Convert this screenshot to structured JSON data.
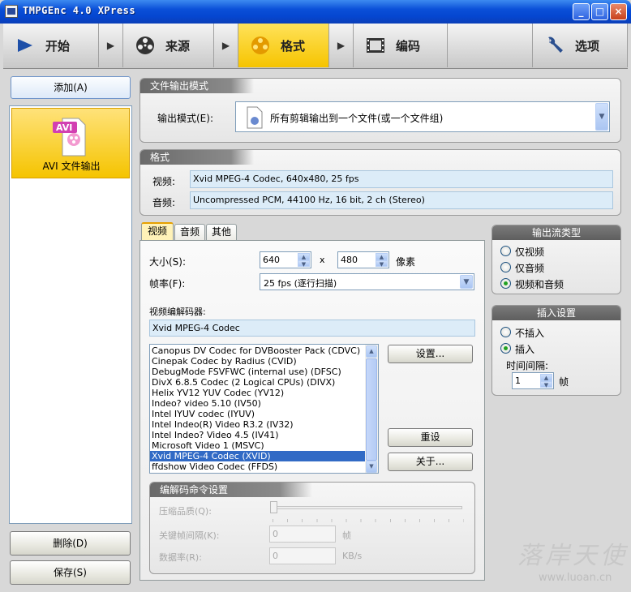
{
  "window": {
    "title": "TMPGEnc 4.0 XPress",
    "controls": {
      "minimize": "_",
      "maximize": "□",
      "close": "×"
    }
  },
  "nav": {
    "tabs": [
      {
        "label": "开始",
        "icon": "play-icon"
      },
      {
        "label": "来源",
        "icon": "film-reel-icon"
      },
      {
        "label": "格式",
        "icon": "film-reel-icon",
        "active": true
      },
      {
        "label": "编码",
        "icon": "filmstrip-icon"
      },
      {
        "label": "选项",
        "icon": "wrench-icon"
      }
    ],
    "arrow": "▶"
  },
  "left": {
    "add_label": "添加(A)",
    "items": [
      {
        "label": "AVI 文件输出",
        "badge": "AVI"
      }
    ],
    "delete_label": "删除(D)",
    "save_label": "保存(S)"
  },
  "output_mode": {
    "header": "文件输出模式",
    "label": "输出模式(E):",
    "value": "所有剪辑输出到一个文件(或一个文件组)"
  },
  "format": {
    "header": "格式",
    "video_label": "视频:",
    "video_value": "Xvid MPEG-4 Codec, 640x480, 25 fps",
    "audio_label": "音频:",
    "audio_value": "Uncompressed PCM, 44100 Hz, 16 bit, 2 ch (Stereo)"
  },
  "tabs": [
    "视频",
    "音频",
    "其他"
  ],
  "video": {
    "size_label": "大小(S):",
    "width": "640",
    "x": "x",
    "height": "480",
    "unit": "像素",
    "framerate_label": "帧率(F):",
    "framerate_value": "25 fps (逐行扫描)",
    "codec_label": "视频编解码器:",
    "codec_value": "Xvid MPEG-4 Codec",
    "codecs": [
      "Canopus DV Codec for DVBooster Pack (CDVC)",
      "Cinepak Codec by Radius (CVID)",
      "DebugMode FSVFWC (internal use) (DFSC)",
      "DivX 6.8.5 Codec (2 Logical CPUs) (DIVX)",
      "Helix YV12 YUV Codec (YV12)",
      "Indeo? video 5.10 (IV50)",
      "Intel IYUV codec (IYUV)",
      "Intel Indeo(R) Video R3.2 (IV32)",
      "Intel Indeo? Video 4.5 (IV41)",
      "Microsoft Video 1 (MSVC)",
      "Xvid MPEG-4 Codec (XVID)",
      "ffdshow Video Codec (FFDS)"
    ],
    "selected_index": 10,
    "settings_button": "设置...",
    "reset_button": "重设",
    "about_button": "关于..."
  },
  "codec_cmd": {
    "header": "编解码命令设置",
    "quality_label": "压缩品质(Q):",
    "keyframe_label": "关键帧间隔(K):",
    "keyframe_value": "0",
    "keyframe_unit": "帧",
    "datarate_label": "数据率(R):",
    "datarate_value": "0",
    "datarate_unit": "KB/s"
  },
  "stream_type": {
    "header": "输出流类型",
    "options": [
      "仅视频",
      "仅音频",
      "视频和音频"
    ],
    "selected": 2
  },
  "insert": {
    "header": "插入设置",
    "options": [
      "不插入",
      "插入"
    ],
    "selected": 1,
    "interval_label": "时间间隔:",
    "interval_value": "1",
    "interval_unit": "帧"
  },
  "watermark": {
    "text": "落岸天使",
    "url": "www.luoan.cn"
  }
}
